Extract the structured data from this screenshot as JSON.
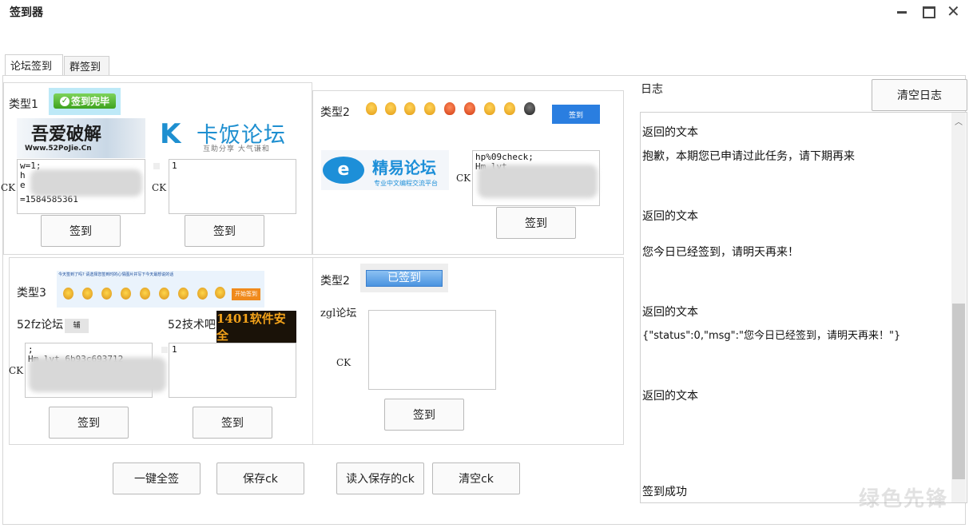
{
  "window": {
    "title": "签到器"
  },
  "tabs": [
    "论坛签到",
    "群签到"
  ],
  "type1": {
    "label": "类型1",
    "badge": "签到完毕",
    "logo_52pojie_top": "吾爱破解",
    "logo_52pojie_url": "Www.52PoJie.Cn",
    "logo_kafan_name": "卡饭论坛",
    "logo_kafan_sub": "互助分享  大气谦和",
    "ck_label": "CK",
    "ck1_lines": [
      "w=1;",
      "h",
      "e",
      "=1584585361"
    ],
    "ck2_lines": [
      "1"
    ],
    "btn1": "签到",
    "btn2": "签到"
  },
  "type2a": {
    "label": "类型2",
    "sign_small": "签到",
    "logo_jy_name": "精易论坛",
    "logo_jy_sub": "专业中文编程交流平台",
    "ck_label": "CK",
    "ck_lines": [
      "hp%09check;",
      "Hm_lvt_"
    ],
    "btn": "签到"
  },
  "type3": {
    "label": "类型3",
    "banner_text": "今天签到了吗? 请选择您签到时的心情图片并写下今天最想说的话",
    "banner_btn": "开始签到",
    "forum1": "52fz论坛",
    "forum1_tag": "辅",
    "forum2": "52技术吧",
    "forum2_logo": "1401软件安全",
    "ck_label": "CK",
    "ck1_lines": [
      ";",
      "Hm_lvt_6b93c693712"
    ],
    "ck2_lines": [
      "1"
    ],
    "btn1": "签到",
    "btn2": "签到"
  },
  "type2b": {
    "label": "类型2",
    "badge": "已签到",
    "forum": "zgl论坛",
    "ck_label": "CK",
    "btn": "签到"
  },
  "bottom_buttons": {
    "sign_all": "一键全签",
    "save_ck": "保存ck",
    "load_ck": "读入保存的ck",
    "clear_ck": "清空ck"
  },
  "log": {
    "title": "日志",
    "clear_btn": "清空日志",
    "lines": [
      "返回的文本",
      "抱歉，本期您已申请过此任务，请下期再来",
      "返回的文本",
      "您今日已经签到，请明天再来！",
      "返回的文本",
      "{\"status\":0,\"msg\":\"您今日已经签到，请明天再来！\"}",
      "返回的文本",
      "签到成功"
    ]
  },
  "watermark": "绿色先锋"
}
